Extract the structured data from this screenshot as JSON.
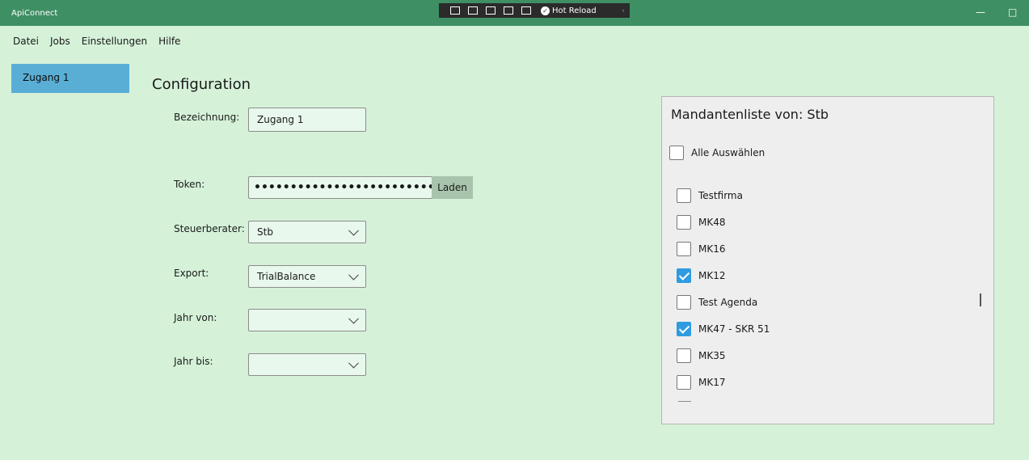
{
  "window": {
    "title": "ApiConnect",
    "minimize": "—",
    "maximize": "□"
  },
  "devtoolbar": {
    "hot_reload": "Hot Reload"
  },
  "menu": [
    "Datei",
    "Jobs",
    "Einstellungen",
    "Hilfe"
  ],
  "sidebar": {
    "items": [
      {
        "label": "Zugang 1",
        "selected": true
      }
    ]
  },
  "config": {
    "title": "Configuration",
    "bezeichnung": {
      "label": "Bezeichnung:",
      "value": "Zugang 1"
    },
    "token": {
      "label": "Token:",
      "value": "•••••••••••••••••••••••••••••",
      "button": "Laden"
    },
    "steuerberater": {
      "label": "Steuerberater:",
      "value": "Stb"
    },
    "export": {
      "label": "Export:",
      "value": "TrialBalance"
    },
    "jahr_von": {
      "label": "Jahr von:",
      "value": ""
    },
    "jahr_bis": {
      "label": "Jahr bis:",
      "value": ""
    }
  },
  "mandanten": {
    "title": "Mandantenliste von: Stb",
    "select_all": "Alle Auswählen",
    "items": [
      {
        "label": "Testfirma",
        "checked": false
      },
      {
        "label": "MK48",
        "checked": false
      },
      {
        "label": "MK16",
        "checked": false
      },
      {
        "label": "MK12",
        "checked": true
      },
      {
        "label": "Test Agenda",
        "checked": false
      },
      {
        "label": "MK47 - SKR 51",
        "checked": true
      },
      {
        "label": "MK35",
        "checked": false
      },
      {
        "label": "MK17",
        "checked": false
      }
    ]
  },
  "colors": {
    "background": "#d5f2d9",
    "titlebar": "#3f8f64",
    "accent": "#59aed6",
    "checkbox": "#2f9be0"
  }
}
